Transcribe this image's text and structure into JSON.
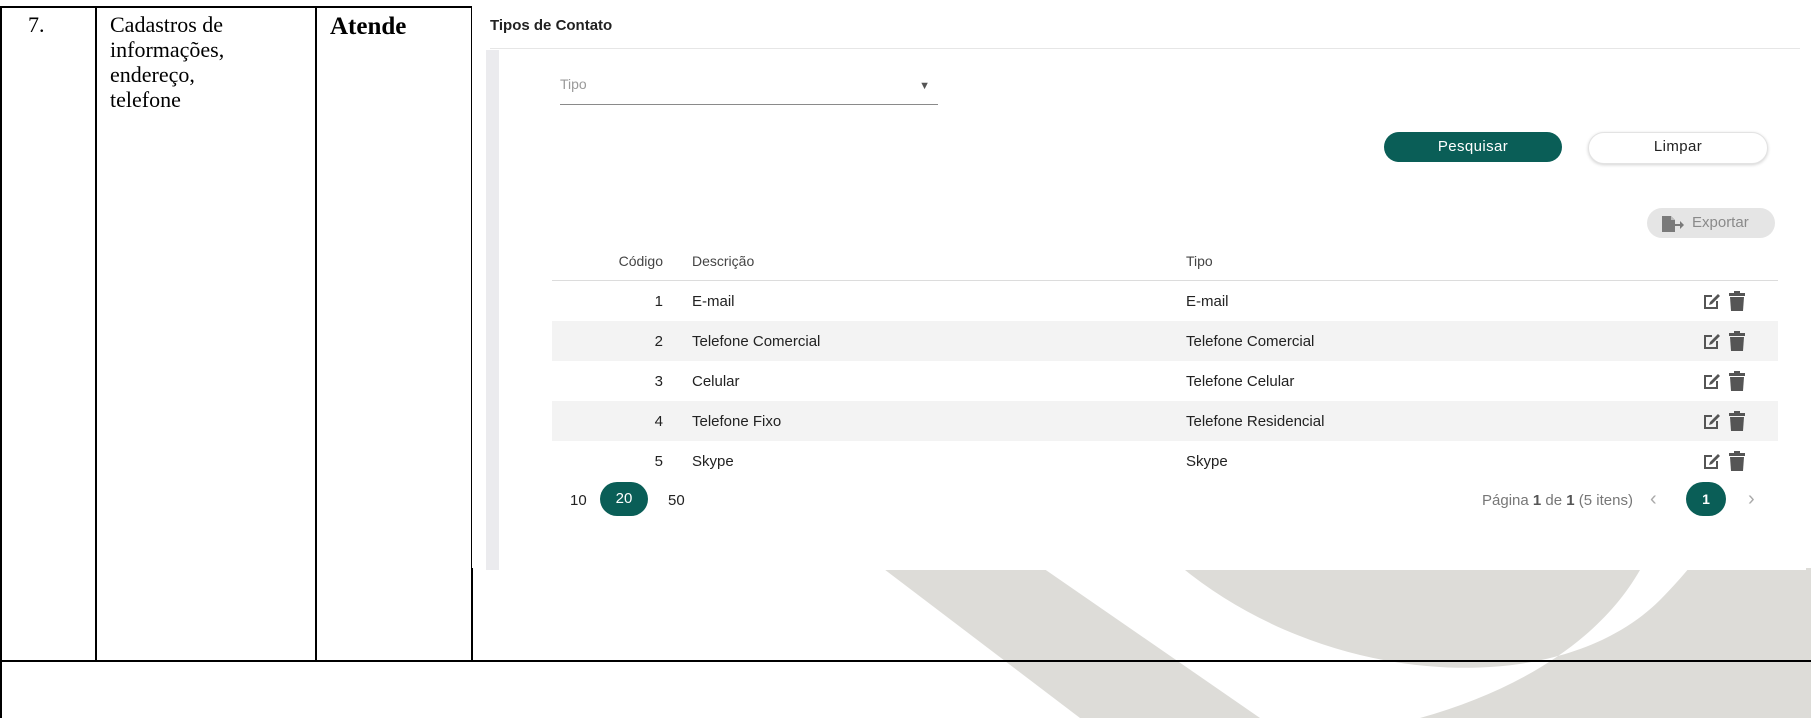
{
  "document": {
    "item_number": "7.",
    "requirement_lines": [
      "Cadastros de",
      "informações,",
      "endereço,",
      "telefone"
    ],
    "status": "Atende"
  },
  "screen": {
    "title": "Tipos de Contato",
    "filter": {
      "label": "Tipo",
      "icon": "caret-down-icon"
    },
    "buttons": {
      "search": "Pesquisar",
      "clear": "Limpar",
      "export": "Exportar",
      "export_icon": "file-export-icon"
    },
    "table": {
      "headers": {
        "code": "Código",
        "description": "Descrição",
        "type": "Tipo"
      },
      "rows": [
        {
          "code": "1",
          "description": "E-mail",
          "type": "E-mail"
        },
        {
          "code": "2",
          "description": "Telefone Comercial",
          "type": "Telefone Comercial"
        },
        {
          "code": "3",
          "description": "Celular",
          "type": "Telefone Celular"
        },
        {
          "code": "4",
          "description": "Telefone Fixo",
          "type": "Telefone Residencial"
        },
        {
          "code": "5",
          "description": "Skype",
          "type": "Skype"
        }
      ],
      "row_action_icons": [
        "edit-icon",
        "trash-icon"
      ]
    },
    "pagination": {
      "page_sizes": [
        "10",
        "20",
        "50"
      ],
      "selected_page_size": "20",
      "info_prefix": "Página ",
      "current_page": "1",
      "info_middle": " de ",
      "total_pages": "1",
      "info_suffix": " (5 itens)",
      "prev": "‹",
      "next": "›"
    }
  },
  "colors": {
    "primary": "#0a5e57",
    "watermark": "#dddcd8"
  }
}
